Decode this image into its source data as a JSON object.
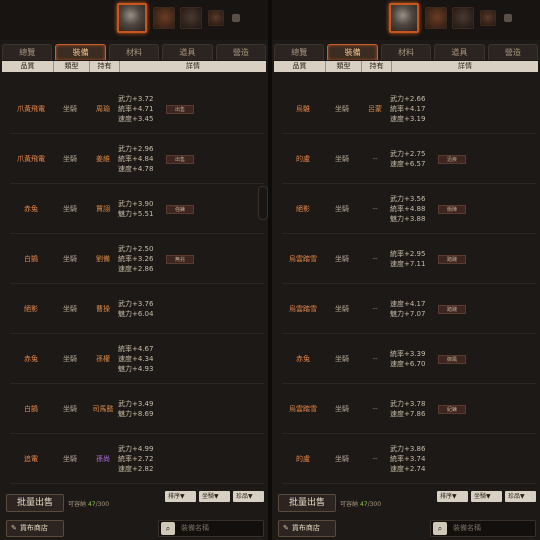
{
  "tabs": [
    "總覽",
    "裝備",
    "材料",
    "道具",
    "營造"
  ],
  "active_tab": "裝備",
  "table_headers": [
    "品質",
    "類型",
    "持有",
    "詳情"
  ],
  "left_rows": [
    {
      "name": "爪黃飛電",
      "type": "坐騎",
      "holder": "周瑜",
      "stats": [
        "武力+3.72",
        "統率+4.71",
        "速度+3.45"
      ],
      "tag": "出售"
    },
    {
      "name": "爪黃飛電",
      "type": "坐騎",
      "holder": "姜維",
      "stats": [
        "武力+2.96",
        "統率+4.84",
        "速度+4.78"
      ],
      "tag": "出售"
    },
    {
      "name": "赤兔",
      "type": "坐騎",
      "holder": "賈詡",
      "stats": [
        "武力+3.90",
        "魅力+5.51"
      ],
      "tag": "強鍊"
    },
    {
      "name": "白鵠",
      "type": "坐騎",
      "holder": "劉備",
      "stats": [
        "武力+2.50",
        "統率+3.26",
        "速度+2.86"
      ],
      "tag": "無兆"
    },
    {
      "name": "絕影",
      "type": "坐騎",
      "holder": "曹操",
      "stats": [
        "武力+3.76",
        "魅力+6.04"
      ],
      "tag": ""
    },
    {
      "name": "赤兔",
      "type": "坐騎",
      "holder": "孫權",
      "stats": [
        "統率+4.67",
        "速度+4.34",
        "魅力+4.93"
      ],
      "tag": ""
    },
    {
      "name": "白鵠",
      "type": "坐騎",
      "holder": "司馬懿",
      "stats": [
        "武力+3.49",
        "魅力+8.69"
      ],
      "tag": ""
    },
    {
      "name": "追電",
      "type": "坐騎",
      "holder": "孫尚",
      "holder_color": "purple",
      "stats": [
        "武力+4.99",
        "統率+2.72",
        "速度+2.82"
      ],
      "tag": ""
    }
  ],
  "right_rows": [
    {
      "name": "烏騅",
      "type": "坐騎",
      "holder": "呂蒙",
      "stats": [
        "武力+2.66",
        "統率+4.17",
        "速度+3.19"
      ],
      "tag": ""
    },
    {
      "name": "的盧",
      "type": "坐騎",
      "holder": "--",
      "stats": [
        "武力+2.75",
        "速度+6.57"
      ],
      "tag": "迅疾"
    },
    {
      "name": "絕影",
      "type": "坐騎",
      "holder": "--",
      "stats": [
        "武力+3.56",
        "統率+4.88",
        "魅力+3.88"
      ],
      "tag": "衝陣"
    },
    {
      "name": "烏雲踏雪",
      "type": "坐騎",
      "holder": "--",
      "stats": [
        "統率+2.95",
        "速度+7.11"
      ],
      "tag": "踏踐"
    },
    {
      "name": "烏雲踏雪",
      "type": "坐騎",
      "holder": "--",
      "stats": [
        "速度+4.17",
        "魅力+7.07"
      ],
      "tag": "踏踐"
    },
    {
      "name": "赤兔",
      "type": "坐騎",
      "holder": "--",
      "stats": [
        "統率+3.39",
        "速度+6.70"
      ],
      "tag": "御風"
    },
    {
      "name": "烏雲踏雪",
      "type": "坐騎",
      "holder": "--",
      "stats": [
        "武力+3.78",
        "速度+7.86"
      ],
      "tag": "紀鍊"
    },
    {
      "name": "的盧",
      "type": "坐騎",
      "holder": "--",
      "stats": [
        "武力+3.86",
        "統率+3.74",
        "速度+2.74"
      ],
      "tag": ""
    }
  ],
  "bulk_sell": "批量出售",
  "capacity_label": "可容納",
  "capacity_used": "47",
  "capacity_total": "/300",
  "filters": [
    "排序▼",
    "坐騎▼",
    "珍品▼"
  ],
  "shop_button": "貨布商店",
  "search_placeholder": "裝備名稱",
  "colors": {
    "accent": "#c8602a",
    "quality_orange": "#e8884a",
    "capacity_green": "#8cc850",
    "holder_purple": "#b070e0"
  }
}
